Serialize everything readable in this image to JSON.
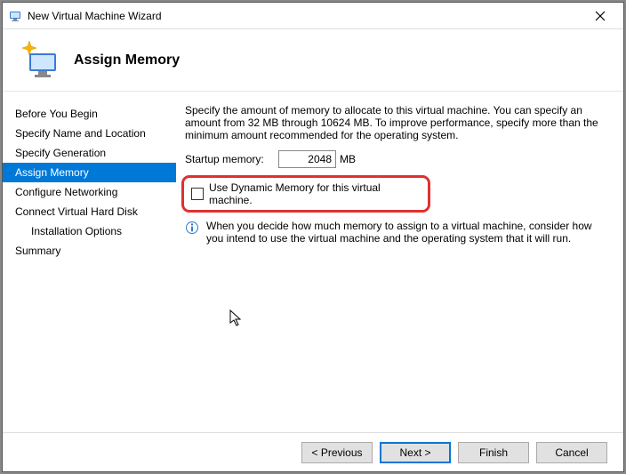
{
  "titlebar": {
    "title": "New Virtual Machine Wizard"
  },
  "header": {
    "title": "Assign Memory"
  },
  "sidebar": {
    "steps": [
      "Before You Begin",
      "Specify Name and Location",
      "Specify Generation",
      "Assign Memory",
      "Configure Networking",
      "Connect Virtual Hard Disk",
      "Installation Options",
      "Summary"
    ]
  },
  "content": {
    "intro": "Specify the amount of memory to allocate to this virtual machine. You can specify an amount from 32 MB through 10624 MB. To improve performance, specify more than the minimum amount recommended for the operating system.",
    "startup_label": "Startup memory:",
    "startup_value": "2048",
    "startup_unit": "MB",
    "dynamic_label": "Use Dynamic Memory for this virtual machine.",
    "info": "When you decide how much memory to assign to a virtual machine, consider how you intend to use the virtual machine and the operating system that it will run."
  },
  "footer": {
    "previous": "< Previous",
    "next": "Next >",
    "finish": "Finish",
    "cancel": "Cancel"
  }
}
